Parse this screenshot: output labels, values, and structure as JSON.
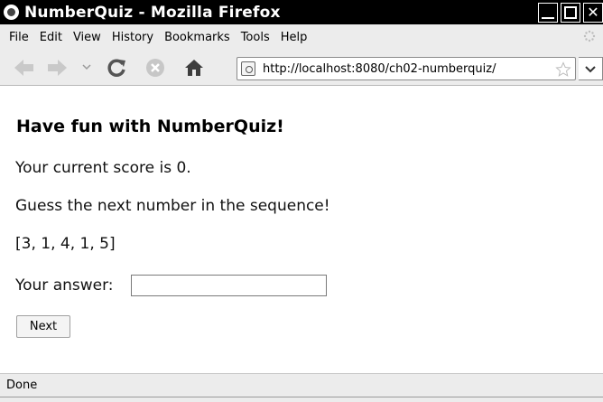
{
  "window": {
    "title": "NumberQuiz - Mozilla Firefox"
  },
  "menubar": {
    "items": [
      "File",
      "Edit",
      "View",
      "History",
      "Bookmarks",
      "Tools",
      "Help"
    ]
  },
  "toolbar": {
    "url": "http://localhost:8080/ch02-numberquiz/",
    "icons": [
      "back-arrow-icon",
      "forward-arrow-icon",
      "history-dropdown-icon",
      "reload-icon",
      "stop-icon",
      "home-icon",
      "site-identity-icon",
      "bookmark-star-icon",
      "url-dropdown-icon"
    ]
  },
  "page": {
    "heading": "Have fun with NumberQuiz!",
    "score_text": "Your current score is 0.",
    "instruction": "Guess the next number in the sequence!",
    "sequence": "[3, 1, 4, 1, 5]",
    "answer_label": "Your answer:",
    "answer_value": "",
    "next_label": "Next"
  },
  "status": {
    "text": "Done"
  }
}
